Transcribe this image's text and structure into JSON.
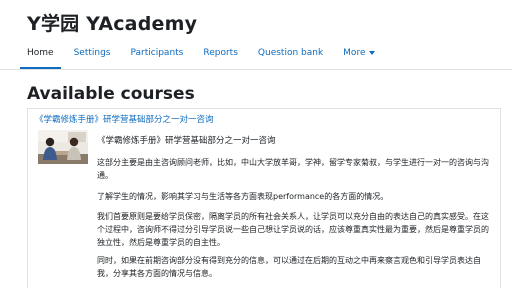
{
  "site": {
    "title": "Y学园 YAcademy"
  },
  "nav": {
    "items": [
      {
        "label": "Home",
        "active": true
      },
      {
        "label": "Settings",
        "active": false
      },
      {
        "label": "Participants",
        "active": false
      },
      {
        "label": "Reports",
        "active": false
      },
      {
        "label": "Question bank",
        "active": false
      }
    ],
    "more_label": "More"
  },
  "page": {
    "heading": "Available courses"
  },
  "course": {
    "link_title": "《学霸修炼手册》研学营基础部分之一对一咨询",
    "summary_title": "《学霸修炼手册》研学营基础部分之一对一咨询",
    "paragraphs": [
      "这部分主要是由主咨询顾问老师，比如，中山大学放羊哥，学神，留学专家菊叔，与学生进行一对一的咨询与沟通。",
      "了解学生的情况，影响其学习与生活等各方面表现performance的各方面的情况。",
      "我们首要原则是要给学员保密，隔离学员的所有社会关系人，让学员可以充分自由的表达自己的真实感受。在这个过程中，咨询师不得过分引导学员说一些自己想让学员说的话，应该尊重真实性最为重要，然后是尊重学员的独立性，然后是尊重学员的自主性。",
      "同时，如果在前期咨询部分没有得到充分的信息，可以通过在后期的互动之中再来察言观色和引导学员表达自我，分享其各方面的情况与信息。"
    ],
    "thumbnail_icon": "consultation-photo-icon"
  },
  "colors": {
    "link": "#0f6cbf",
    "text": "#1d2125",
    "border": "#dee2e6"
  }
}
